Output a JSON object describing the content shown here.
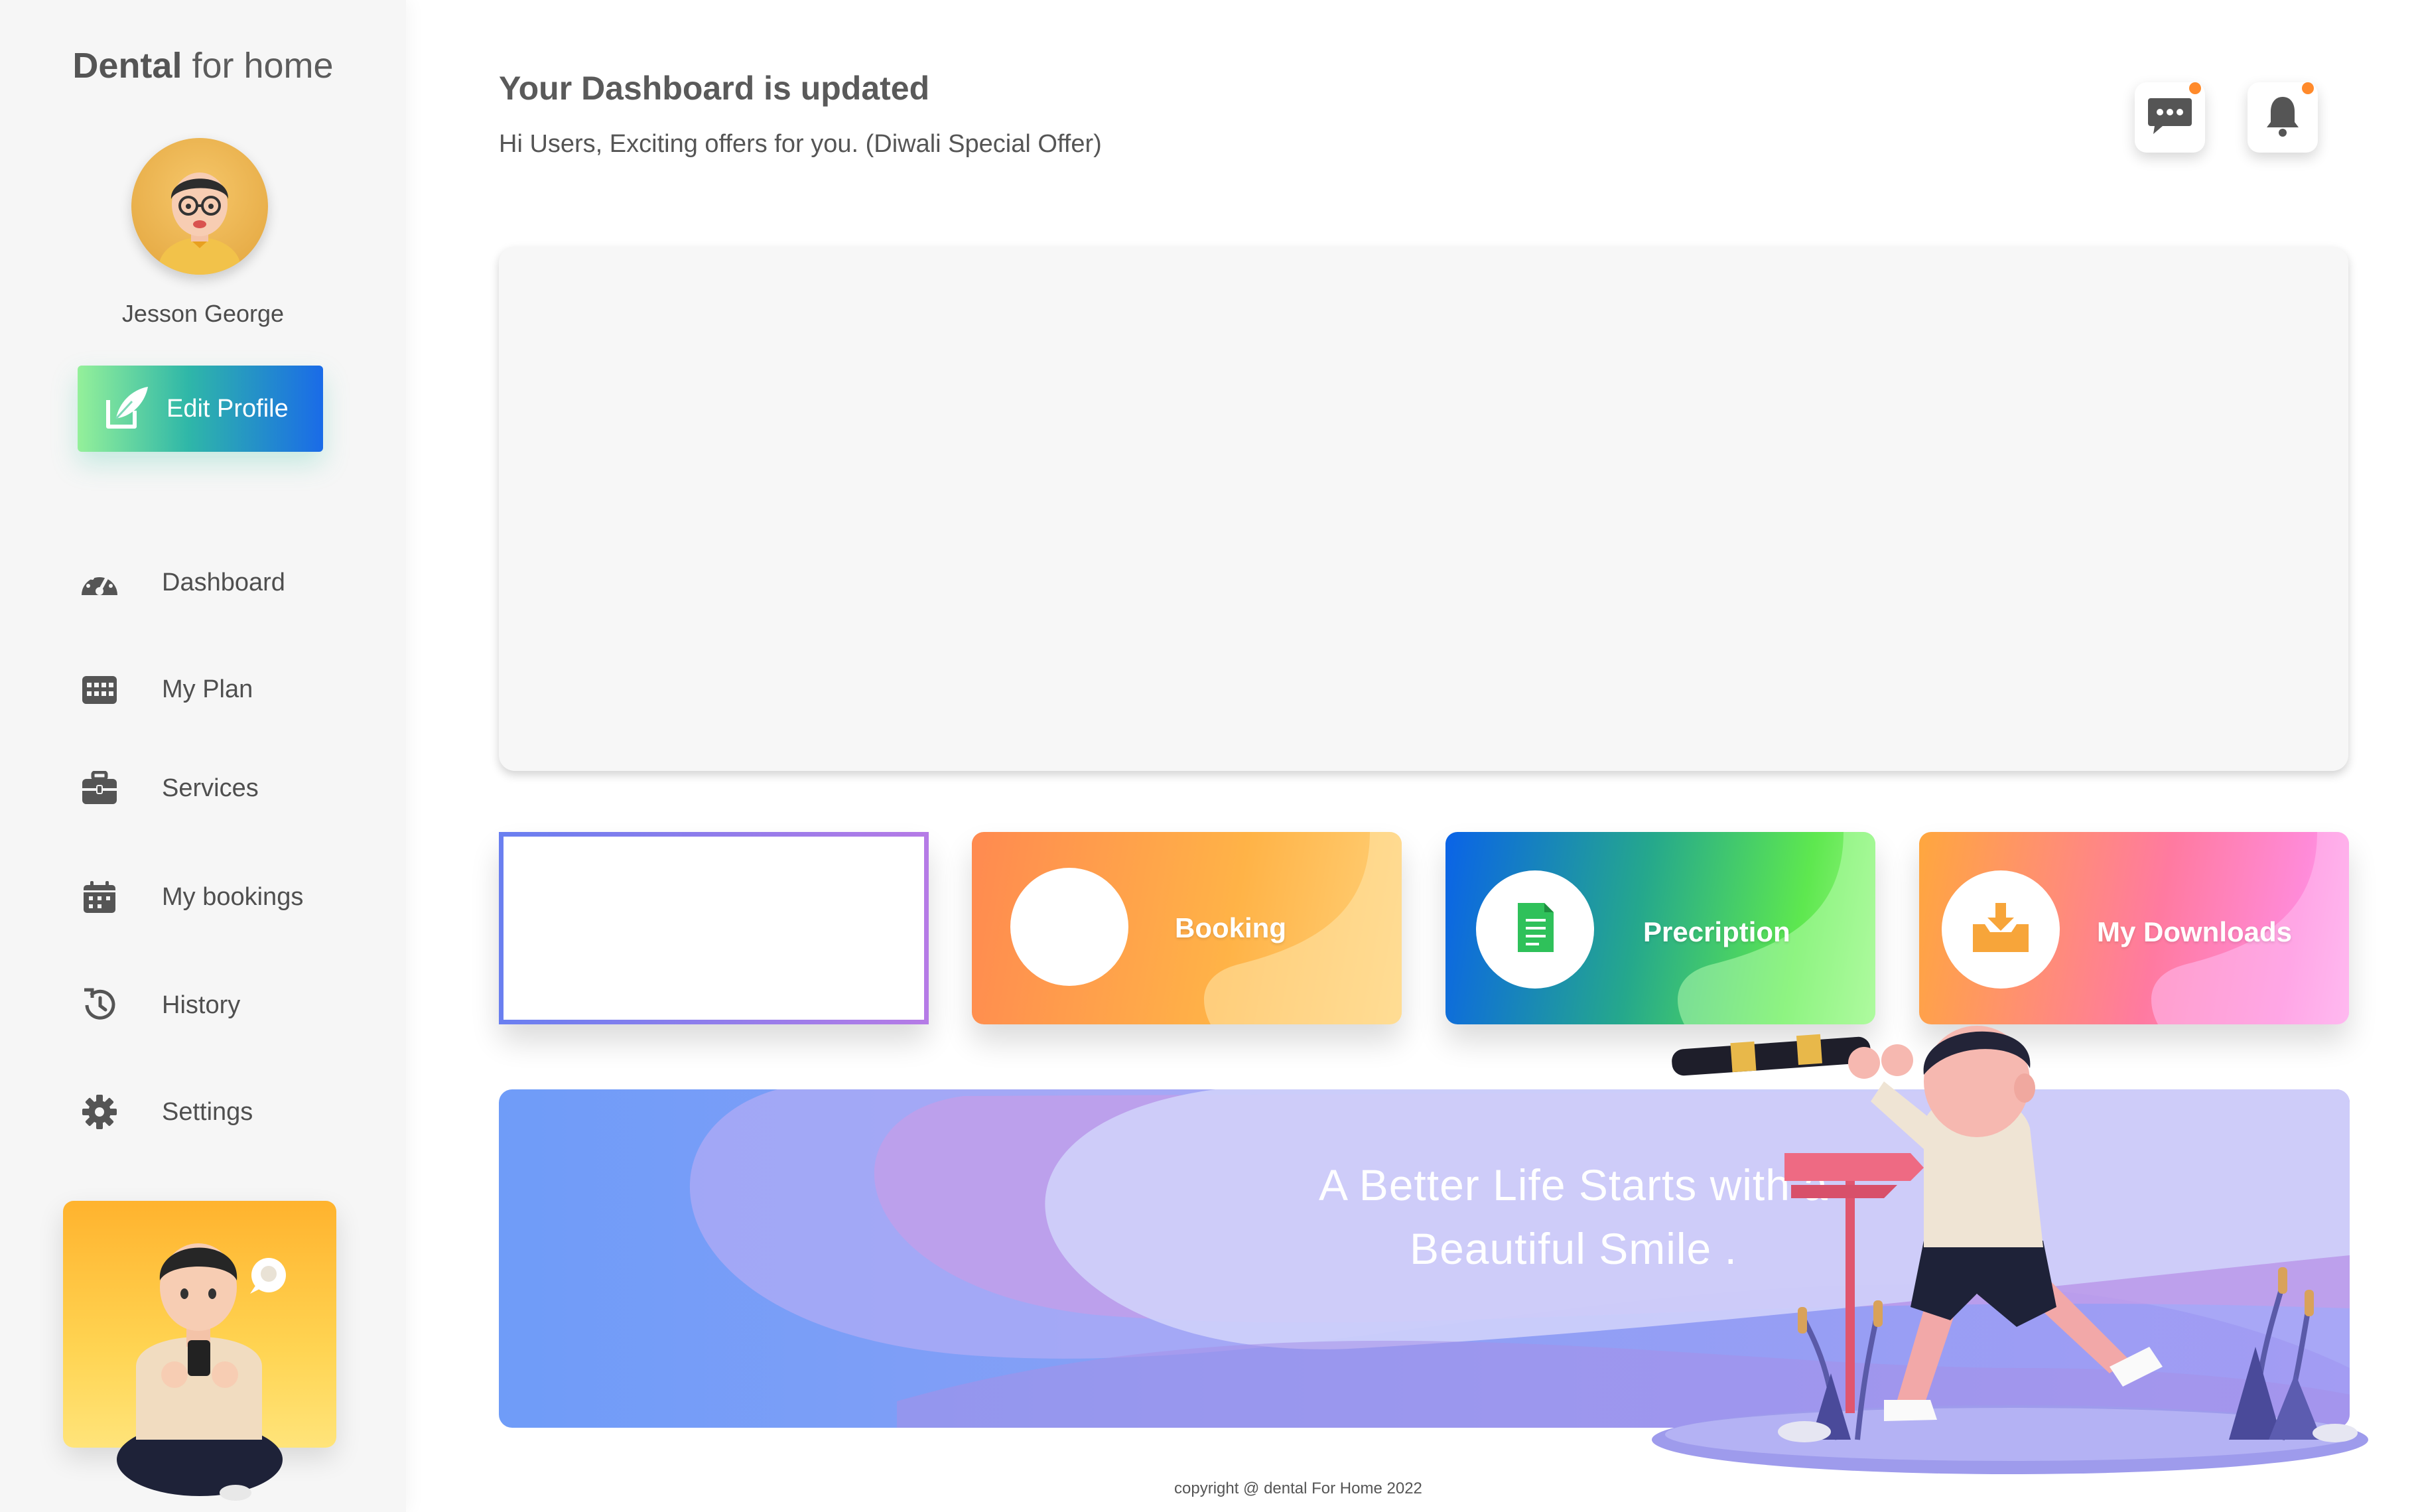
{
  "brand": {
    "bold": "Dental",
    "rest": " for home"
  },
  "user": {
    "name": "Jesson George",
    "edit_label": "Edit Profile"
  },
  "nav": [
    {
      "label": "Dashboard",
      "icon": "dashboard-gauge-icon"
    },
    {
      "label": "My Plan",
      "icon": "calendar-grid-icon"
    },
    {
      "label": "Services",
      "icon": "briefcase-icon"
    },
    {
      "label": "My bookings",
      "icon": "calendar-icon"
    },
    {
      "label": "History",
      "icon": "history-icon"
    },
    {
      "label": "Settings",
      "icon": "gear-icon"
    }
  ],
  "header": {
    "title": "Your Dashboard is updated",
    "subtitle": "Hi Users, Exciting offers for you. (Diwali Special Offer)"
  },
  "cards": {
    "booking": "Booking",
    "prescription": "Precription",
    "downloads": "My Downloads"
  },
  "promo": {
    "line1": "A Better Life Starts with a",
    "line2": "Beautiful Smile ."
  },
  "footer": "copyright @ dental For Home 2022",
  "colors": {
    "accent_orange": "#ff8a2b",
    "text_gray": "#4f4f4f",
    "sidebar_bg": "#f6f6f6"
  }
}
